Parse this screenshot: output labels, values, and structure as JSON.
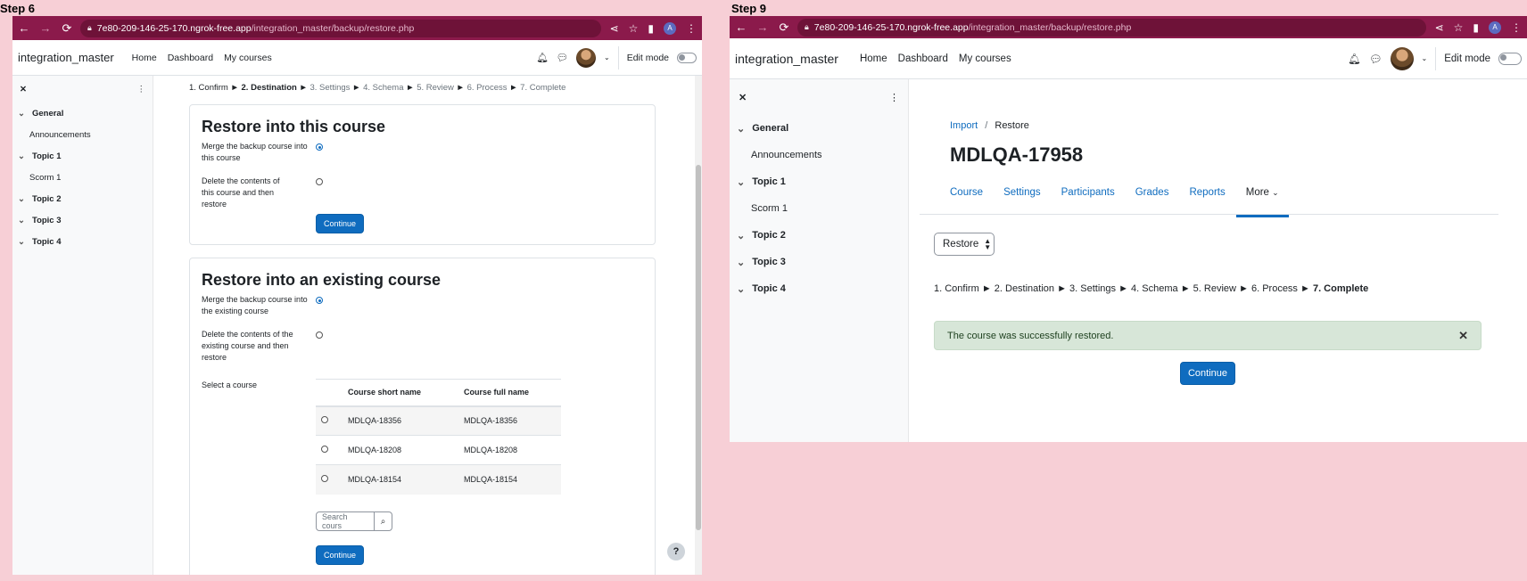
{
  "steps": {
    "left": "Step 6",
    "right": "Step 9"
  },
  "browser": {
    "domain": "7e80-209-146-25-170.ngrok-free.app",
    "path": "/integration_master/backup/restore.php",
    "profile": "A"
  },
  "site": {
    "name": "integration_master",
    "nav": [
      "Home",
      "Dashboard",
      "My courses"
    ],
    "edit_mode": "Edit mode"
  },
  "drawer": {
    "sections": [
      {
        "name": "General",
        "activity": "Announcements"
      },
      {
        "name": "Topic 1",
        "activity": "Scorm 1"
      },
      {
        "name": "Topic 2"
      },
      {
        "name": "Topic 3"
      },
      {
        "name": "Topic 4"
      }
    ]
  },
  "left": {
    "stages": [
      {
        "label": "1. Confirm",
        "state": "done"
      },
      {
        "label": "2. Destination",
        "state": "current"
      },
      {
        "label": "3. Settings",
        "state": "todo"
      },
      {
        "label": "4. Schema",
        "state": "todo"
      },
      {
        "label": "5. Review",
        "state": "todo"
      },
      {
        "label": "6. Process",
        "state": "todo"
      },
      {
        "label": "7. Complete",
        "state": "todo"
      }
    ],
    "arrow": "►",
    "card1": {
      "title": "Restore into this course",
      "opt1": "Merge the backup course into this course",
      "opt2": "Delete the contents of this course and then restore",
      "continue": "Continue"
    },
    "card2": {
      "title": "Restore into an existing course",
      "opt1": "Merge the backup course into the existing course",
      "opt2": "Delete the contents of the existing course and then restore",
      "select_label": "Select a course",
      "col_short": "Course short name",
      "col_full": "Course full name",
      "rows": [
        {
          "short": "MDLQA-18356",
          "full": "MDLQA-18356"
        },
        {
          "short": "MDLQA-18208",
          "full": "MDLQA-18208"
        },
        {
          "short": "MDLQA-18154",
          "full": "MDLQA-18154"
        }
      ],
      "search_placeholder": "Search cours",
      "continue": "Continue"
    },
    "help": "?"
  },
  "right": {
    "breadcrumb": {
      "link": "Import",
      "sep": "/",
      "current": "Restore"
    },
    "title": "MDLQA-17958",
    "tabs": [
      "Course",
      "Settings",
      "Participants",
      "Grades",
      "Reports",
      "More"
    ],
    "select": "Restore",
    "stages": [
      "1. Confirm",
      "2. Destination",
      "3. Settings",
      "4. Schema",
      "5. Review",
      "6. Process",
      "7. Complete"
    ],
    "alert": "The course was successfully restored.",
    "continue": "Continue"
  }
}
